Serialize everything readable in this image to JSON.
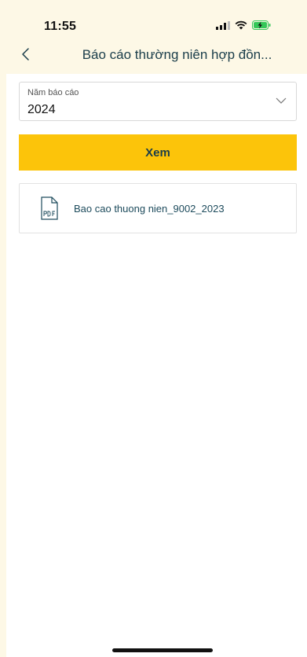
{
  "status": {
    "time": "11:55"
  },
  "nav": {
    "title": "Báo cáo thường niên hợp đồn..."
  },
  "form": {
    "year_label": "Năm báo cáo",
    "year_value": "2024",
    "view_button": "Xem"
  },
  "files": [
    {
      "icon": "pdf-icon",
      "name": "Bao cao thuong nien_9002_2023"
    }
  ],
  "colors": {
    "background": "#fdf8e6",
    "accent": "#fcc40a",
    "title_text": "#1a3d4a",
    "battery": "#34c759"
  }
}
